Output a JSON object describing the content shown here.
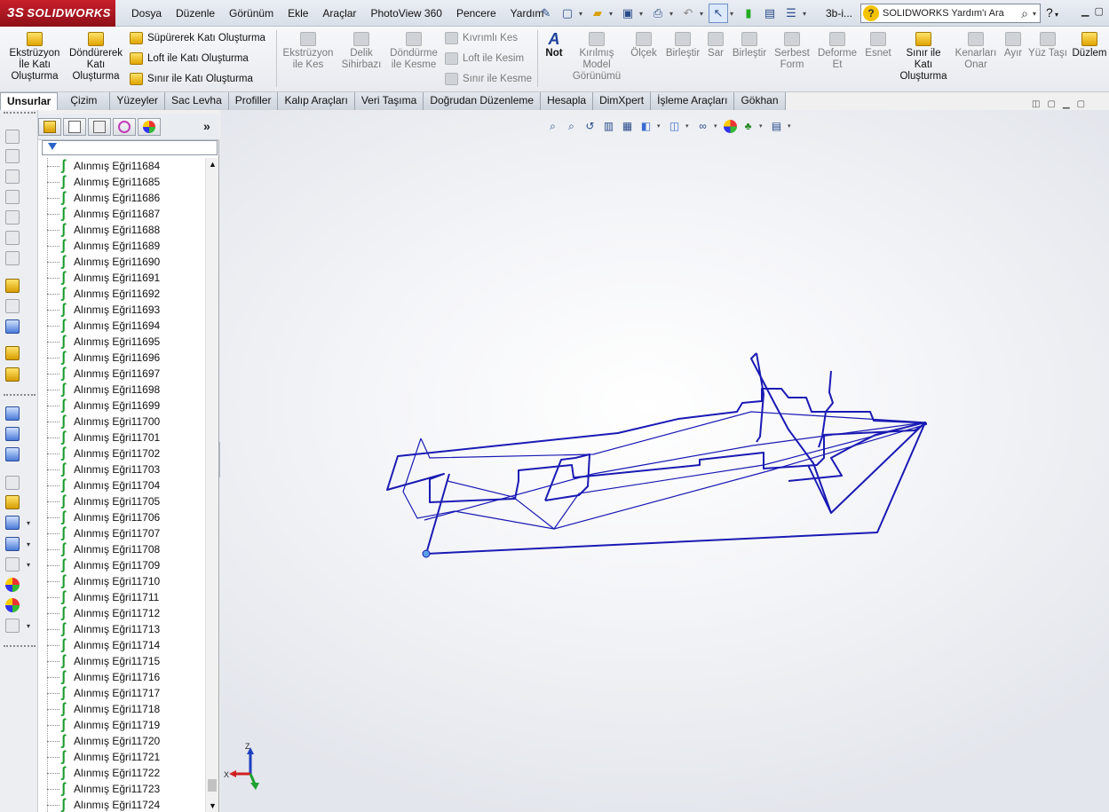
{
  "app": {
    "brand_prefix": "3S",
    "brand": "SOLIDWORKS",
    "doc_title": "3b-i...",
    "help_search_placeholder": "SOLIDWORKS Yardım'ı Ara"
  },
  "menu": [
    "Dosya",
    "Düzenle",
    "Görünüm",
    "Ekle",
    "Araçlar",
    "PhotoView 360",
    "Pencere",
    "Yardım"
  ],
  "ribbon": {
    "extrude_boss": "Ekstrüzyon İle Katı Oluşturma",
    "revolve_boss": "Döndürerek Katı Oluşturma",
    "sweep_boss": "Süpürerek Katı Oluşturma",
    "loft_boss": "Loft ile Katı Oluşturma",
    "boundary_boss": "Sınır ile Katı Oluşturma",
    "extrude_cut": "Ekstrüzyon ile Kes",
    "hole_wizard": "Delik Sihirbazı",
    "revolve_cut": "Döndürme ile Kesme",
    "swept_cut": "Kıvrımlı Kes",
    "lofted_cut": "Loft ile Kesim",
    "boundary_cut": "Sınır ile Kesme",
    "note": "Not",
    "broken_view": "Kırılmış Model Görünümü",
    "scale": "Ölçek",
    "combine": "Birleştir",
    "wrap": "Sar",
    "combine2": "Birleştir",
    "freeform": "Serbest Form",
    "deform": "Deforme Et",
    "flex": "Esnet",
    "boundary_boss2": "Sınır ile Katı Oluşturma",
    "heal_edges": "Kenarları Onar",
    "split": "Ayır",
    "move_face": "Yüz Taşı",
    "plane": "Düzlem"
  },
  "tabs": [
    "Unsurlar",
    "Çizim",
    "Yüzeyler",
    "Sac Levha",
    "Profiller",
    "Kalıp Araçları",
    "Veri Taşıma",
    "Doğrudan Düzenleme",
    "Hesapla",
    "DimXpert",
    "İşleme Araçları",
    "Gökhan"
  ],
  "active_tab": "Unsurlar",
  "feature_tree": {
    "items": [
      "Alınmış Eğri11684",
      "Alınmış Eğri11685",
      "Alınmış Eğri11686",
      "Alınmış Eğri11687",
      "Alınmış Eğri11688",
      "Alınmış Eğri11689",
      "Alınmış Eğri11690",
      "Alınmış Eğri11691",
      "Alınmış Eğri11692",
      "Alınmış Eğri11693",
      "Alınmış Eğri11694",
      "Alınmış Eğri11695",
      "Alınmış Eğri11696",
      "Alınmış Eğri11697",
      "Alınmış Eğri11698",
      "Alınmış Eğri11699",
      "Alınmış Eğri11700",
      "Alınmış Eğri11701",
      "Alınmış Eğri11702",
      "Alınmış Eğri11703",
      "Alınmış Eğri11704",
      "Alınmış Eğri11705",
      "Alınmış Eğri11706",
      "Alınmış Eğri11707",
      "Alınmış Eğri11708",
      "Alınmış Eğri11709",
      "Alınmış Eğri11710",
      "Alınmış Eğri11711",
      "Alınmış Eğri11712",
      "Alınmış Eğri11713",
      "Alınmış Eğri11714",
      "Alınmış Eğri11715",
      "Alınmış Eğri11716",
      "Alınmış Eğri11717",
      "Alınmış Eğri11718",
      "Alınmış Eğri11719",
      "Alınmış Eğri11720",
      "Alınmış Eğri11721",
      "Alınmış Eğri11722",
      "Alınmış Eğri11723",
      "Alınmış Eğri11724"
    ]
  },
  "triad": {
    "z": "Z",
    "x": "X"
  },
  "colors": {
    "wire": "#1a1ab4",
    "curve_icon": "#199a2b",
    "brand_red": "#c8202b"
  },
  "icons": {
    "help": "question-icon",
    "search": "magnifier-icon",
    "filter": "filter-icon"
  }
}
